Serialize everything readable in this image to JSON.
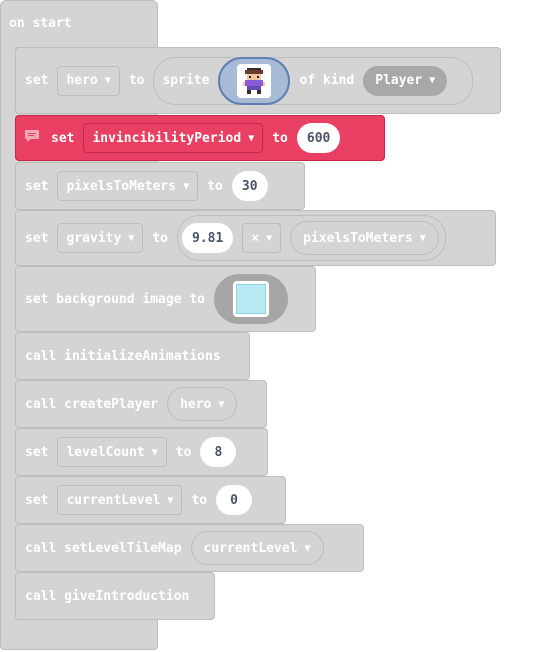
{
  "hat": {
    "label": "on start"
  },
  "rows": {
    "hero": {
      "set": "set",
      "variable": "hero",
      "to": "to",
      "sprite": "sprite",
      "of_kind": "of kind",
      "kind": "Player"
    },
    "invincibility": {
      "set": "set",
      "variable": "invincibilityPeriod",
      "to": "to",
      "value": "600",
      "comment_icon": "comment-icon"
    },
    "pixels": {
      "set": "set",
      "variable": "pixelsToMeters",
      "to": "to",
      "value": "30"
    },
    "gravity": {
      "set": "set",
      "variable": "gravity",
      "to": "to",
      "left": "9.81",
      "operator": "×",
      "right_variable": "pixelsToMeters"
    },
    "background": {
      "label": "set background image to"
    },
    "init_anim": {
      "label": "call initializeAnimations"
    },
    "create_player": {
      "label": "call createPlayer",
      "arg": "hero"
    },
    "level_count": {
      "set": "set",
      "variable": "levelCount",
      "to": "to",
      "value": "8"
    },
    "current_level": {
      "set": "set",
      "variable": "currentLevel",
      "to": "to",
      "value": "0"
    },
    "tilemap": {
      "label": "call setLevelTileMap",
      "arg": "currentLevel"
    },
    "intro": {
      "label": "call giveIntroduction"
    }
  },
  "colors": {
    "block_gray": "#d4d4d4",
    "block_red": "#e83f62",
    "sprite_blue": "#a8bbd6",
    "bg_cyan": "#b9eaf3"
  }
}
